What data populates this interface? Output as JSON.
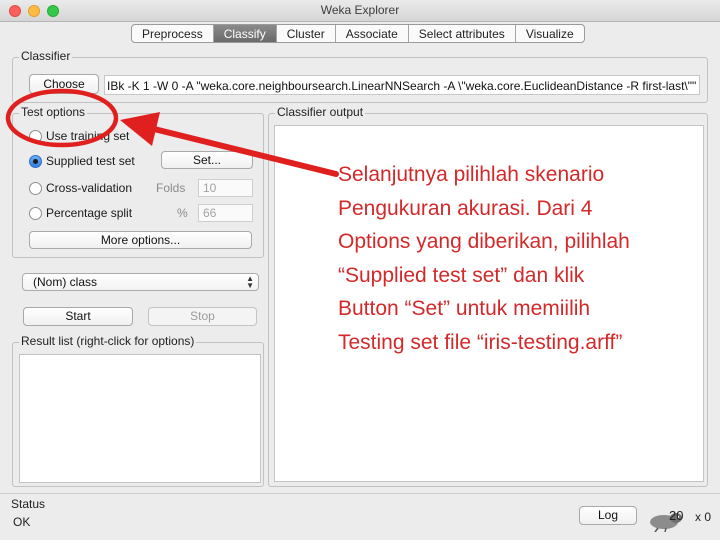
{
  "window": {
    "title": "Weka Explorer"
  },
  "tabs": [
    {
      "label": "Preprocess"
    },
    {
      "label": "Classify"
    },
    {
      "label": "Cluster"
    },
    {
      "label": "Associate"
    },
    {
      "label": "Select attributes"
    },
    {
      "label": "Visualize"
    }
  ],
  "classifier": {
    "group_label": "Classifier",
    "choose_label": "Choose",
    "command": "IBk -K 1 -W 0 -A \"weka.core.neighboursearch.LinearNNSearch -A \\\"weka.core.EuclideanDistance -R first-last\\\"\""
  },
  "test_options": {
    "group_label": "Test options",
    "use_training_set": "Use training set",
    "supplied_test_set": "Supplied test set",
    "set_button": "Set...",
    "cross_validation": "Cross-validation",
    "folds_label": "Folds",
    "folds_value": "10",
    "percentage_split": "Percentage split",
    "percent_label": "%",
    "percent_value": "66",
    "more_options": "More options..."
  },
  "class_select": {
    "value": "(Nom) class"
  },
  "actions": {
    "start": "Start",
    "stop": "Stop"
  },
  "result_list": {
    "label": "Result list (right-click for options)"
  },
  "output": {
    "label": "Classifier output"
  },
  "status": {
    "label": "Status",
    "text": "OK",
    "log_button": "Log",
    "x_count": "x 0"
  },
  "annotation": {
    "lines": [
      "Selanjutnya pilihlah skenario",
      "Pengukuran akurasi. Dari 4",
      "Options yang diberikan, pilihlah",
      "“Supplied test set” dan klik",
      "Button “Set” untuk memiilih",
      "Testing set file “iris-testing.arff”"
    ]
  },
  "page_number": "20",
  "colors": {
    "annotation": "#d4292a",
    "active_tab": "#6a6a6a"
  }
}
